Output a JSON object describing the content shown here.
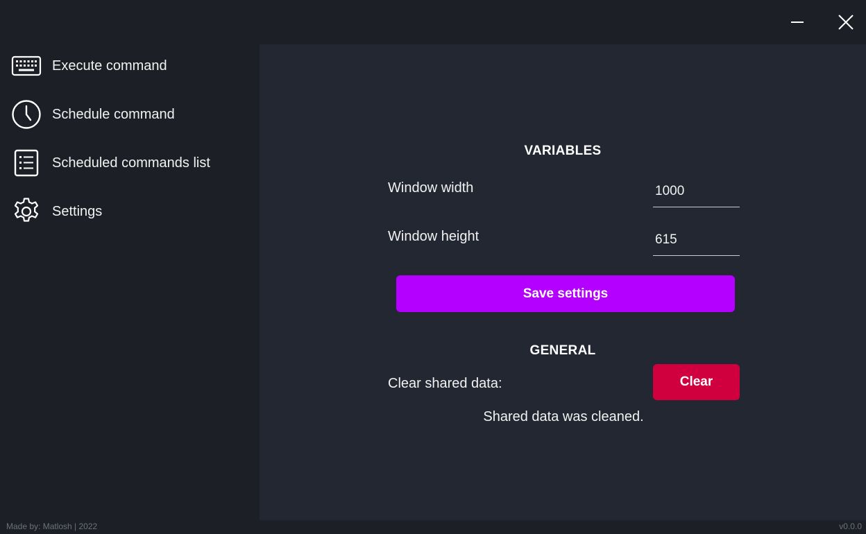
{
  "window": {
    "minimize_icon": "minimize-icon",
    "close_icon": "close-icon"
  },
  "sidebar": {
    "items": [
      {
        "label": "Execute command",
        "icon": "keyboard-icon"
      },
      {
        "label": "Schedule command",
        "icon": "clock-icon"
      },
      {
        "label": "Scheduled commands list",
        "icon": "list-icon"
      },
      {
        "label": "Settings",
        "icon": "gear-icon"
      }
    ]
  },
  "settings": {
    "variables_title": "VARIABLES",
    "window_width_label": "Window width",
    "window_width_value": "1000",
    "window_height_label": "Window height",
    "window_height_value": "615",
    "save_label": "Save settings",
    "general_title": "GENERAL",
    "clear_shared_label": "Clear shared data:",
    "clear_button_label": "Clear",
    "status_message": "Shared data was cleaned."
  },
  "footer": {
    "credit": "Made by: Matlosh | 2022",
    "version": "v0.0.0"
  },
  "colors": {
    "background": "#1c1f26",
    "panel": "#222732",
    "save_button": "#b300ff",
    "clear_button": "#d0003f"
  }
}
